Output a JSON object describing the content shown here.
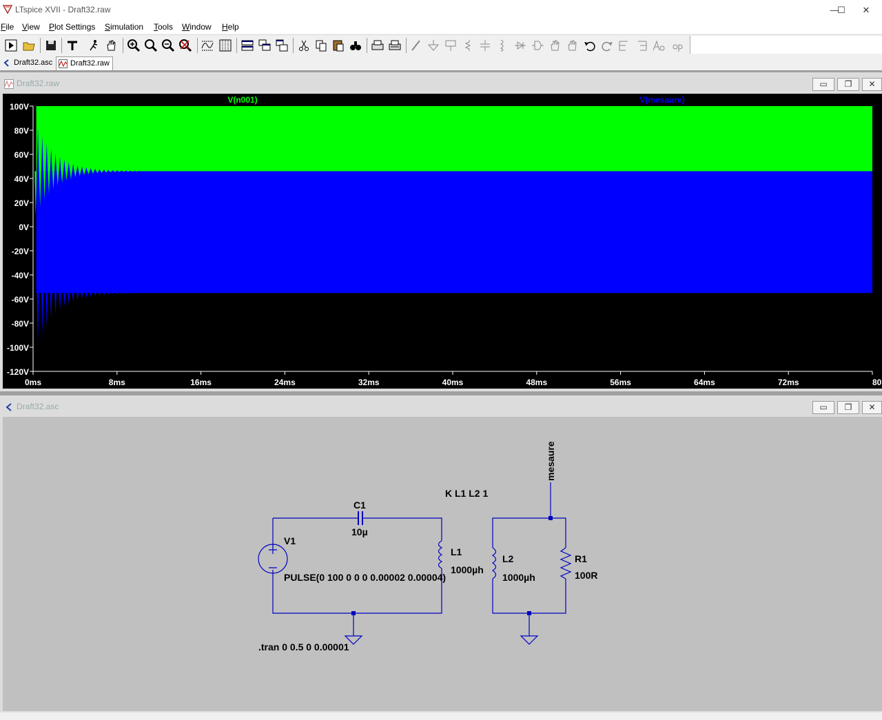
{
  "window": {
    "title": "LTspice XVII - Draft32.raw",
    "minimize": "—",
    "maximize": "☐",
    "close": "✕"
  },
  "menu": [
    {
      "label": "File",
      "key": "F"
    },
    {
      "label": "View",
      "key": "V"
    },
    {
      "label": "Plot Settings",
      "key": "P"
    },
    {
      "label": "Simulation",
      "key": "S"
    },
    {
      "label": "Tools",
      "key": "T"
    },
    {
      "label": "Window",
      "key": "W"
    },
    {
      "label": "Help",
      "key": "H"
    }
  ],
  "tabs": [
    {
      "label": "Draft32.asc",
      "icon": "schematic-icon"
    },
    {
      "label": "Draft32.raw",
      "icon": "waveform-icon"
    }
  ],
  "plot_window": {
    "title": "Draft32.raw",
    "buttons": [
      "▭",
      "❐",
      "✕"
    ]
  },
  "schematic_window": {
    "title": "Draft32.asc",
    "buttons": [
      "▭",
      "❐",
      "✕"
    ]
  },
  "chart_data": {
    "type": "line",
    "background": "#000000",
    "series": [
      {
        "name": "V(n001)",
        "color": "#00ff00",
        "steady_max": 100,
        "steady_min": 46,
        "initial_swing_min": 4
      },
      {
        "name": "V(mesaure)",
        "color": "#0000ff",
        "steady_max": 46,
        "steady_min": -55,
        "initial_swing_max": 88,
        "initial_swing_min": -104
      }
    ],
    "xlim": [
      0,
      80
    ],
    "ylim": [
      -120,
      100
    ],
    "x_ticks": [
      "0ms",
      "8ms",
      "16ms",
      "24ms",
      "32ms",
      "40ms",
      "48ms",
      "56ms",
      "64ms",
      "72ms",
      "80ms"
    ],
    "y_ticks": [
      "100V",
      "80V",
      "60V",
      "40V",
      "20V",
      "0V",
      "-20V",
      "-40V",
      "-60V",
      "-80V",
      "-100V",
      "-120V"
    ],
    "tick_color": "#ffffff"
  },
  "schematic": {
    "wire_color": "#0000c0",
    "labels": {
      "c1_name": "C1",
      "c1_value": "10µ",
      "v1_name": "V1",
      "v1_value": "PULSE(0 100 0 0 0 0.00002 0.00004)",
      "l1_name": "L1",
      "l1_value": "1000µh",
      "l2_name": "L2",
      "l2_value": "1000µh",
      "r1_name": "R1",
      "r1_value": "100R",
      "coupling": "K L1 L2 1",
      "tran": ".tran 0 0.5 0 0.00001",
      "net": "mesaure"
    }
  }
}
